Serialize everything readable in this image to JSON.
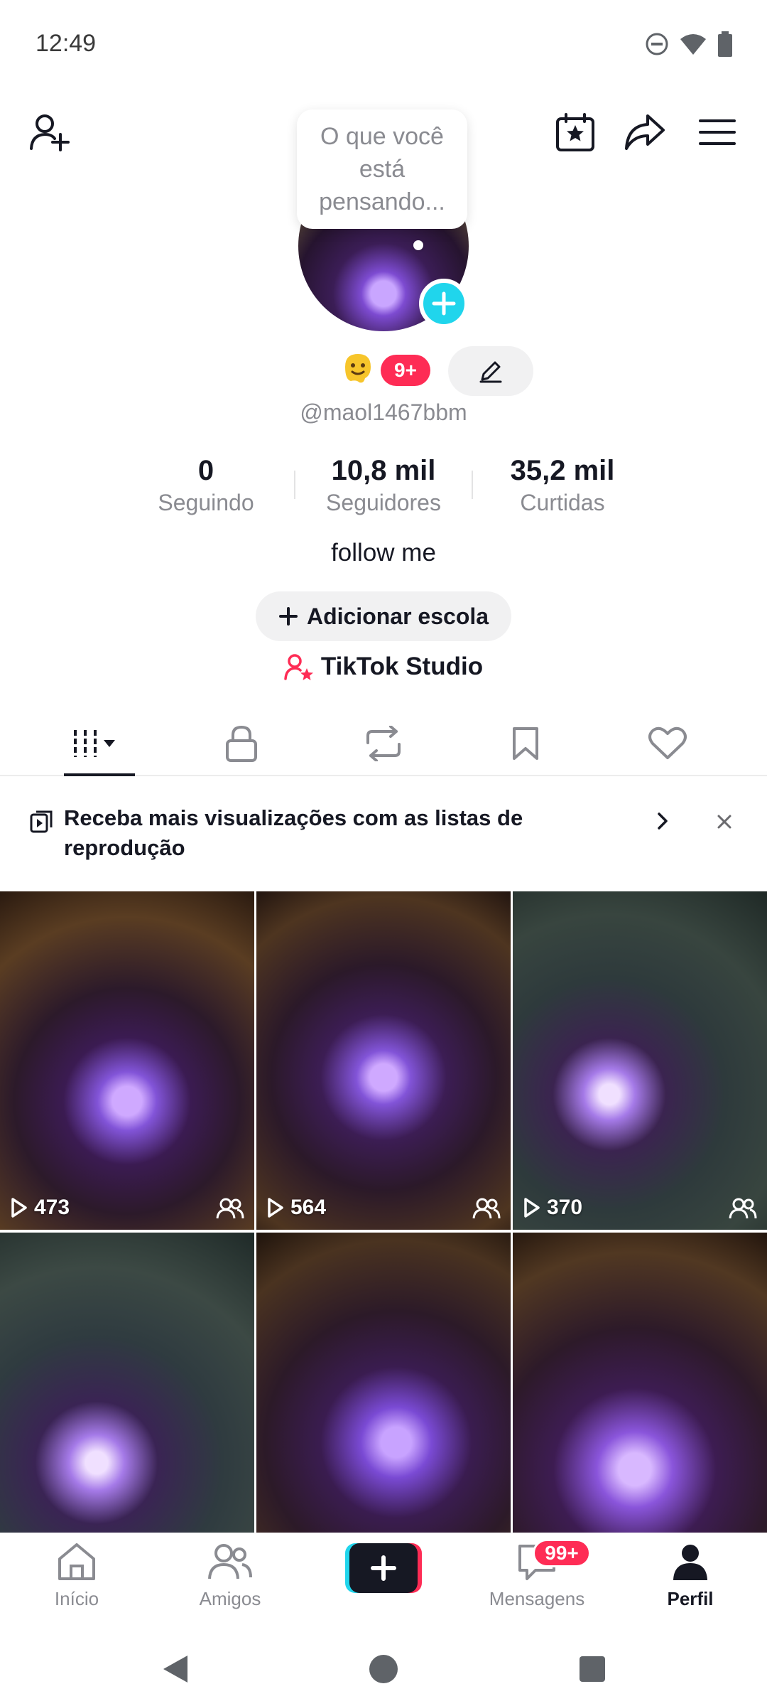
{
  "status_bar": {
    "time": "12:49"
  },
  "profile": {
    "thought_bubble": "O que você está pensando...",
    "badge_count": "9+",
    "username": "@maol1467bbm",
    "bio": "follow me",
    "add_school_label": "Adicionar escola",
    "studio_label": "TikTok Studio"
  },
  "stats": [
    {
      "value": "0",
      "label": "Seguindo"
    },
    {
      "value": "10,8 mil",
      "label": "Seguidores"
    },
    {
      "value": "35,2 mil",
      "label": "Curtidas"
    }
  ],
  "banner": {
    "text": "Receba mais visualizações com as listas de reprodução"
  },
  "videos": [
    {
      "views": "473"
    },
    {
      "views": "564"
    },
    {
      "views": "370"
    },
    {
      "views": ""
    },
    {
      "views": ""
    },
    {
      "views": ""
    }
  ],
  "bottom_nav": {
    "home": "Início",
    "friends": "Amigos",
    "messages": "Mensagens",
    "messages_badge": "99+",
    "profile": "Perfil"
  },
  "colors": {
    "accent_red": "#fe2c55",
    "accent_cyan": "#20d5ec",
    "text_primary": "#161823",
    "text_secondary": "#8a8b91"
  }
}
